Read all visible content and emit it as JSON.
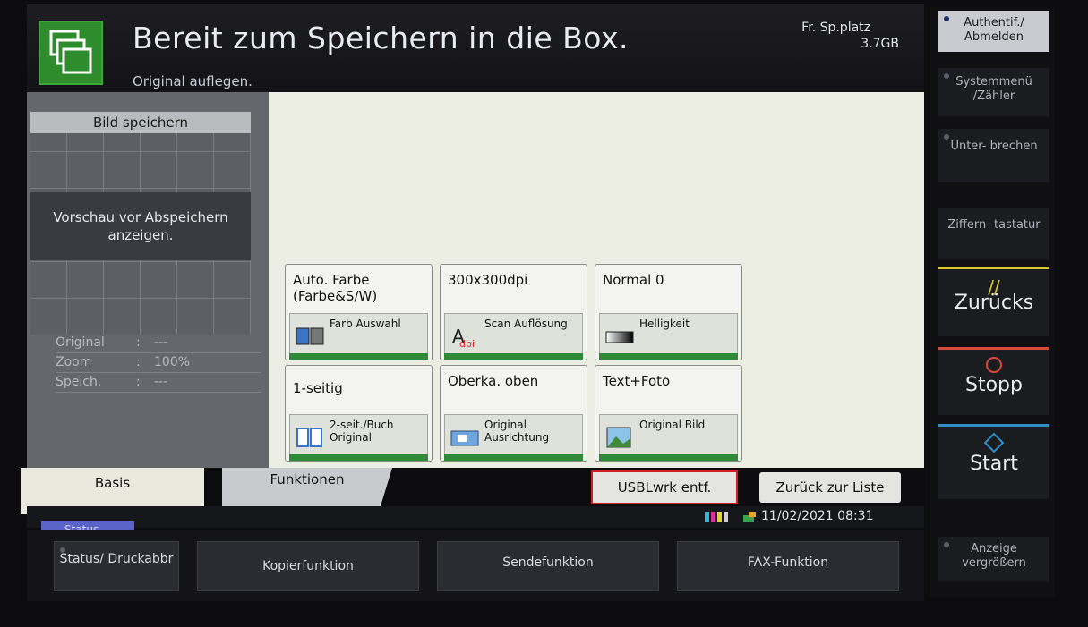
{
  "header": {
    "title": "Bereit zum Speichern in die Box.",
    "subtitle": "Original auflegen.",
    "free_space_label": "Fr. Sp.platz",
    "free_space_value": "3.7GB"
  },
  "preview": {
    "title": "Bild speichern",
    "button": "Vorschau vor Abspeichern anzeigen.",
    "info": [
      {
        "label": "Original",
        "sep": ":",
        "value": "---"
      },
      {
        "label": "Zoom",
        "sep": ":",
        "value": "100%"
      },
      {
        "label": "Speich.",
        "sep": ":",
        "value": "---"
      }
    ]
  },
  "tiles": [
    {
      "value": "Auto. Farbe (Farbe&S/W)",
      "label": "Farb Auswahl",
      "icon": "color-select-icon"
    },
    {
      "value": "300x300dpi",
      "label": "Scan Auflösung",
      "icon": "dpi-icon"
    },
    {
      "value": "Normal 0",
      "label": "Helligkeit",
      "icon": "brightness-icon"
    },
    {
      "value": "1-seitig",
      "label": "2-seit./Buch Original",
      "icon": "duplex-icon"
    },
    {
      "value": "Oberka. oben",
      "label": "Original Ausrichtung",
      "icon": "orientation-icon"
    },
    {
      "value": "Text+Foto",
      "label": "Original Bild",
      "icon": "image-type-icon"
    }
  ],
  "tabs": {
    "basis": "Basis",
    "funktionen": "Funktionen"
  },
  "actions": {
    "usb_remove": "USBLwrk entf.",
    "back_to_list": "Zurück zur Liste"
  },
  "status": {
    "tab": "Status",
    "datetime": "11/02/2021  08:31"
  },
  "bottom_bar": {
    "status": "Status/ Druckabbr",
    "copy": "Kopierfunktion",
    "send": "Sendefunktion",
    "fax": "FAX-Funktion"
  },
  "right_panel": {
    "auth": "Authentif./ Abmelden",
    "system_menu": "Systemmenü /Zähler",
    "interrupt": "Unter- brechen",
    "keypad": "Ziffern- tastatur",
    "reset": "Zurücks",
    "stop": "Stopp",
    "start": "Start",
    "enlarge": "Anzeige vergrößern"
  },
  "colors": {
    "accent_green": "#2e8a36",
    "highlight_red": "#d21f23",
    "status_blue": "#5a63c7",
    "reset_yellow": "#d8c832",
    "stop_red": "#d84a3a",
    "start_blue": "#2f8fc7"
  }
}
